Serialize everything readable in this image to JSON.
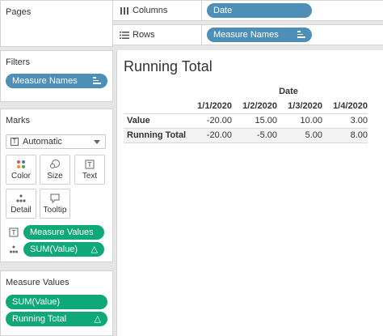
{
  "pages": {
    "title": "Pages"
  },
  "shelves": {
    "columns": {
      "label": "Columns",
      "pill": "Date"
    },
    "rows": {
      "label": "Rows",
      "pill": "Measure Names"
    }
  },
  "filters": {
    "title": "Filters",
    "pill": "Measure Names"
  },
  "marks": {
    "title": "Marks",
    "type_label": "Automatic",
    "buttons": [
      "Color",
      "Size",
      "Text",
      "Detail",
      "Tooltip"
    ],
    "text_pill": "Measure Values",
    "detail_pill": "SUM(Value)"
  },
  "measure_values": {
    "title": "Measure Values",
    "items": [
      "SUM(Value)",
      "Running Total"
    ]
  },
  "view": {
    "title": "Running Total",
    "column_group": "Date",
    "columns": [
      "1/1/2020",
      "1/2/2020",
      "1/3/2020",
      "1/4/2020"
    ],
    "rows": [
      {
        "label": "Value",
        "values": [
          "-20.00",
          "15.00",
          "10.00",
          "3.00"
        ]
      },
      {
        "label": "Running Total",
        "values": [
          "-20.00",
          "-5.00",
          "5.00",
          "8.00"
        ]
      }
    ]
  },
  "colors": {
    "blue_pill": "#4d8fb7",
    "green_pill": "#0ea977"
  },
  "icons": {
    "sort": "sort-icon",
    "delta": "△",
    "columns": "columns-icon",
    "rows": "rows-icon"
  }
}
